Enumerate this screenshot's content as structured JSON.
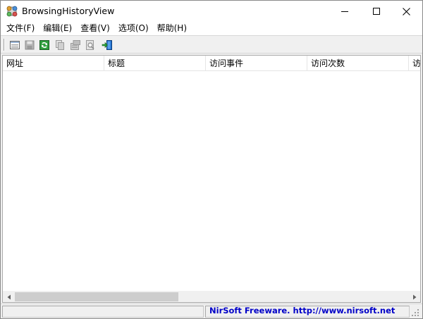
{
  "window": {
    "title": "BrowsingHistoryView"
  },
  "menu": {
    "items": [
      {
        "label": "文件(F)"
      },
      {
        "label": "编辑(E)"
      },
      {
        "label": "查看(V)"
      },
      {
        "label": "选项(O)"
      },
      {
        "label": "帮助(H)"
      }
    ]
  },
  "toolbar": {
    "buttons": [
      {
        "icon": "html-report-icon",
        "enabled": true
      },
      {
        "icon": "save-icon",
        "enabled": false
      },
      {
        "icon": "refresh-icon",
        "enabled": true
      },
      {
        "icon": "copy-icon",
        "enabled": false
      },
      {
        "icon": "properties-icon",
        "enabled": false
      },
      {
        "icon": "find-icon",
        "enabled": false
      },
      {
        "icon": "exit-icon",
        "enabled": true
      }
    ]
  },
  "list": {
    "columns": [
      {
        "label": "网址"
      },
      {
        "label": "标题"
      },
      {
        "label": "访问事件"
      },
      {
        "label": "访问次数"
      },
      {
        "label": "访问"
      }
    ],
    "rows": []
  },
  "status": {
    "link_text": "NirSoft Freeware.  http://www.nirsoft.net"
  },
  "colors": {
    "link": "#0000c8",
    "refresh_green": "#2e9e3c",
    "exit_blue": "#1e6fd0"
  }
}
